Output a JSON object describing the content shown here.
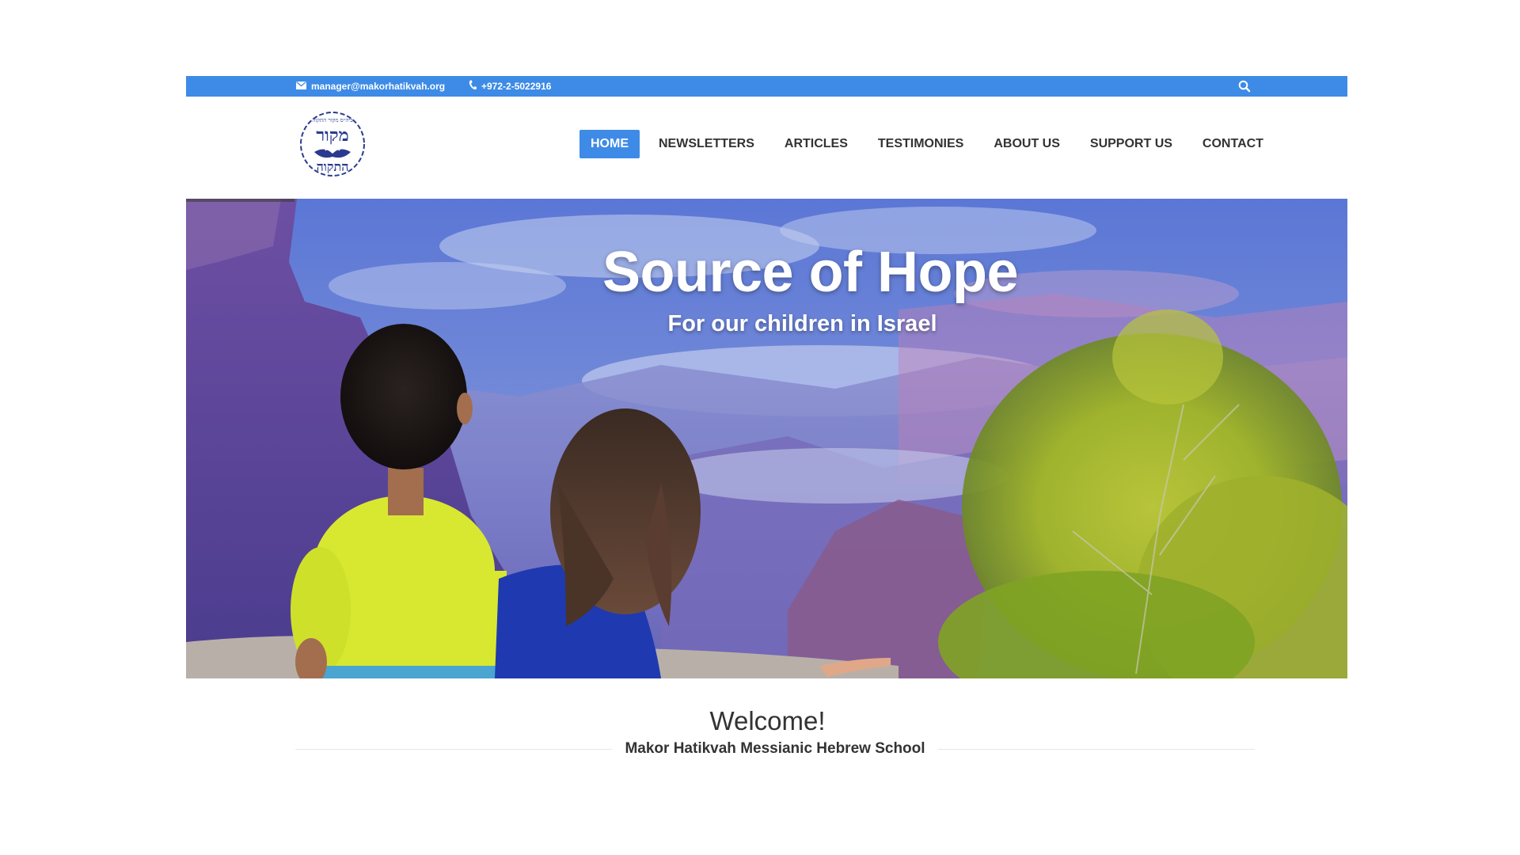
{
  "topbar": {
    "email": "manager@makorhatikvah.org",
    "phone": "+972-2-5022916",
    "email_icon": "envelope-icon",
    "phone_icon": "phone-icon",
    "search_icon": "search-icon"
  },
  "nav": {
    "items": [
      {
        "label": "HOME",
        "active": true
      },
      {
        "label": "NEWSLETTERS",
        "active": false
      },
      {
        "label": "ARTICLES",
        "active": false
      },
      {
        "label": "TESTIMONIES",
        "active": false
      },
      {
        "label": "ABOUT US",
        "active": false
      },
      {
        "label": "SUPPORT US",
        "active": false
      },
      {
        "label": "CONTACT",
        "active": false
      }
    ]
  },
  "hero": {
    "title": "Source of Hope",
    "subtitle": "For our children in Israel"
  },
  "welcome": {
    "title": "Welcome!",
    "subtitle": "Makor Hatikvah Messianic Hebrew School"
  },
  "colors": {
    "accent": "#3d8be6",
    "text": "#333333",
    "logo_blue": "#2b3a8f"
  }
}
